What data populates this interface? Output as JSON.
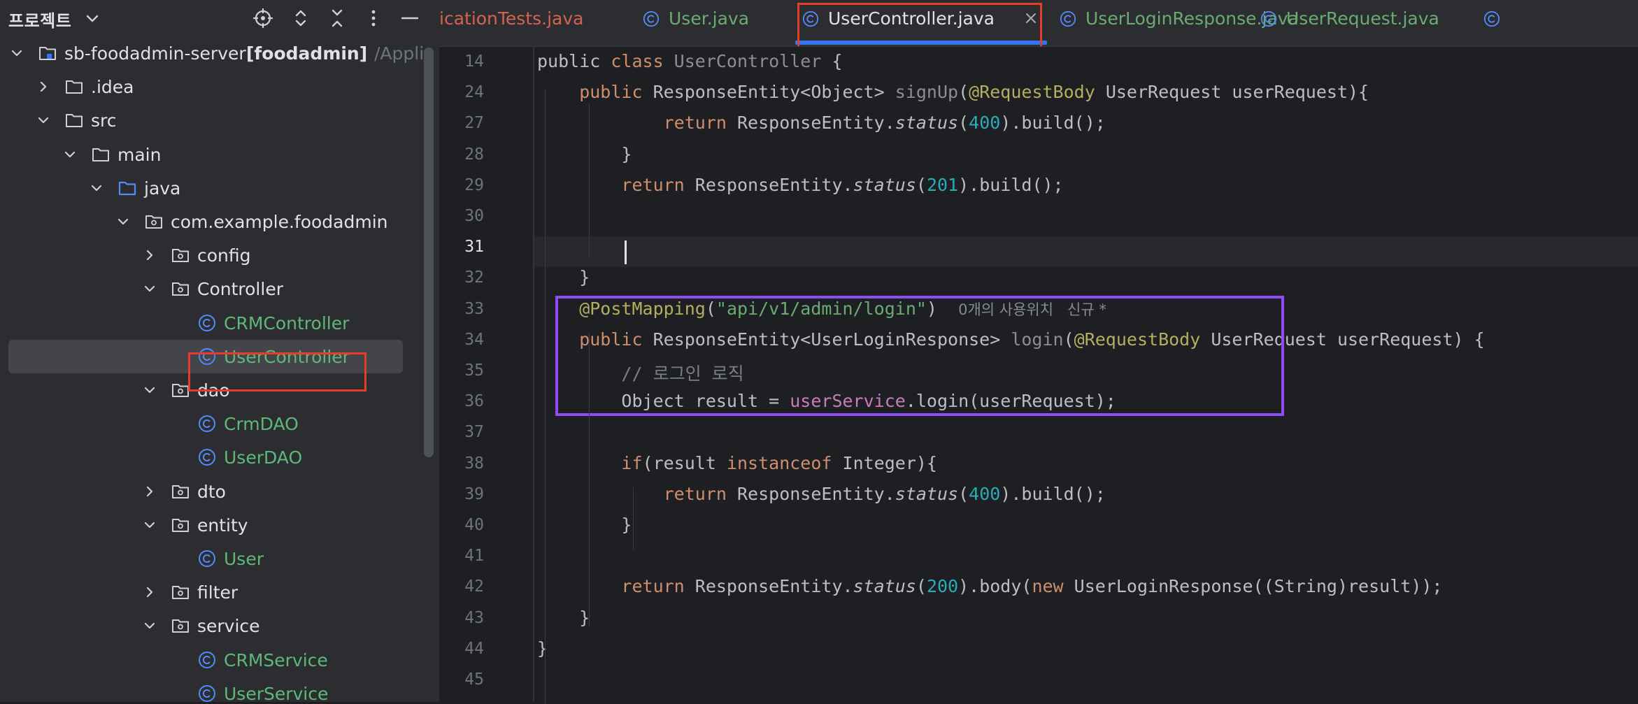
{
  "project_panel": {
    "title": "프로젝트",
    "tree": [
      {
        "label": "sb-foodadmin-server",
        "suffix": " [foodadmin]",
        "path": "/Applic",
        "depth": 0,
        "icon": "module-folder-icon",
        "expanded": true,
        "kind": "module"
      },
      {
        "label": ".idea",
        "depth": 1,
        "icon": "folder-icon",
        "expanded": false,
        "kind": "folder"
      },
      {
        "label": "src",
        "depth": 1,
        "icon": "folder-icon",
        "expanded": true,
        "kind": "folder"
      },
      {
        "label": "main",
        "depth": 2,
        "icon": "folder-icon",
        "expanded": true,
        "kind": "folder"
      },
      {
        "label": "java",
        "depth": 3,
        "icon": "source-folder-icon",
        "expanded": true,
        "kind": "source"
      },
      {
        "label": "com.example.foodadmin",
        "depth": 4,
        "icon": "package-icon",
        "expanded": true,
        "kind": "package"
      },
      {
        "label": "config",
        "depth": 5,
        "icon": "package-icon",
        "expanded": false,
        "kind": "package"
      },
      {
        "label": "Controller",
        "depth": 5,
        "icon": "package-icon",
        "expanded": true,
        "kind": "package"
      },
      {
        "label": "CRMController",
        "depth": 6,
        "icon": "class-icon",
        "kind": "class"
      },
      {
        "label": "UserController",
        "depth": 6,
        "icon": "class-icon",
        "kind": "class",
        "selected": true
      },
      {
        "label": "dao",
        "depth": 5,
        "icon": "package-icon",
        "expanded": true,
        "kind": "package"
      },
      {
        "label": "CrmDAO",
        "depth": 6,
        "icon": "class-icon",
        "kind": "class"
      },
      {
        "label": "UserDAO",
        "depth": 6,
        "icon": "class-icon",
        "kind": "class"
      },
      {
        "label": "dto",
        "depth": 5,
        "icon": "package-icon",
        "expanded": false,
        "kind": "package"
      },
      {
        "label": "entity",
        "depth": 5,
        "icon": "package-icon",
        "expanded": true,
        "kind": "package"
      },
      {
        "label": "User",
        "depth": 6,
        "icon": "class-icon",
        "kind": "class"
      },
      {
        "label": "filter",
        "depth": 5,
        "icon": "package-icon",
        "expanded": false,
        "kind": "package"
      },
      {
        "label": "service",
        "depth": 5,
        "icon": "package-icon",
        "expanded": true,
        "kind": "package"
      },
      {
        "label": "CRMService",
        "depth": 6,
        "icon": "class-icon",
        "kind": "class"
      },
      {
        "label": "UserService",
        "depth": 6,
        "icon": "class-icon",
        "kind": "class"
      }
    ]
  },
  "tabs": [
    {
      "label": "icationTests.java",
      "icon": null,
      "color": "red"
    },
    {
      "label": "User.java",
      "icon": "class-icon",
      "color": "green"
    },
    {
      "label": "UserController.java",
      "icon": "class-icon",
      "color": "active",
      "active": true
    },
    {
      "label": "UserLoginResponse.java",
      "icon": "class-icon",
      "color": "green"
    },
    {
      "label": "UserRequest.java",
      "icon": "class-icon",
      "color": "green"
    },
    {
      "label": "",
      "icon": "class-icon",
      "color": "green"
    }
  ],
  "editor": {
    "current_line": 31,
    "lines": [
      {
        "no": 14,
        "tokens": [
          [
            "t",
            "public "
          ],
          [
            "kw",
            "class "
          ],
          [
            "unused",
            "UserController"
          ],
          [
            "t",
            " {"
          ]
        ]
      },
      {
        "no": 24,
        "tokens": [
          [
            "kw",
            "    public "
          ],
          [
            "t",
            "ResponseEntity<Object> "
          ],
          [
            "unused",
            "signUp"
          ],
          [
            "t",
            "("
          ],
          [
            "ann",
            "@RequestBody"
          ],
          [
            "t",
            " UserRequest userRequest){"
          ]
        ]
      },
      {
        "no": 27,
        "tokens": [
          [
            "kw",
            "            return "
          ],
          [
            "t",
            "ResponseEntity."
          ],
          [
            "it",
            "status"
          ],
          [
            "t",
            "("
          ],
          [
            "num",
            "400"
          ],
          [
            "t",
            ").build();"
          ]
        ]
      },
      {
        "no": 28,
        "tokens": [
          [
            "t",
            "        }"
          ]
        ]
      },
      {
        "no": 29,
        "tokens": [
          [
            "kw",
            "        return "
          ],
          [
            "t",
            "ResponseEntity."
          ],
          [
            "it",
            "status"
          ],
          [
            "t",
            "("
          ],
          [
            "num",
            "201"
          ],
          [
            "t",
            ").build();"
          ]
        ]
      },
      {
        "no": 30,
        "tokens": []
      },
      {
        "no": 31,
        "tokens": []
      },
      {
        "no": 32,
        "tokens": [
          [
            "t",
            "    }"
          ]
        ]
      },
      {
        "no": 33,
        "tokens": [
          [
            "ann",
            "    @PostMapping"
          ],
          [
            "t",
            "("
          ],
          [
            "str",
            "\"api/v1/admin/login\""
          ],
          [
            "t",
            ")  "
          ],
          [
            "hint",
            "0개의 사용위치   신규 *"
          ]
        ]
      },
      {
        "no": 34,
        "tokens": [
          [
            "kw",
            "    public "
          ],
          [
            "t",
            "ResponseEntity<UserLoginResponse> "
          ],
          [
            "unused",
            "login"
          ],
          [
            "t",
            "("
          ],
          [
            "ann",
            "@RequestBody"
          ],
          [
            "t",
            " UserRequest userRequest) {"
          ]
        ]
      },
      {
        "no": 35,
        "tokens": [
          [
            "cmt",
            "        // 로그인 로직"
          ]
        ]
      },
      {
        "no": 36,
        "tokens": [
          [
            "t",
            "        Object result = "
          ],
          [
            "fld",
            "userService"
          ],
          [
            "t",
            ".login(userRequest);"
          ]
        ]
      },
      {
        "no": 37,
        "tokens": []
      },
      {
        "no": 38,
        "tokens": [
          [
            "kw",
            "        if"
          ],
          [
            "t",
            "(result "
          ],
          [
            "kw",
            "instanceof "
          ],
          [
            "t",
            "Integer){"
          ]
        ]
      },
      {
        "no": 39,
        "tokens": [
          [
            "kw",
            "            return "
          ],
          [
            "t",
            "ResponseEntity."
          ],
          [
            "it",
            "status"
          ],
          [
            "t",
            "("
          ],
          [
            "num",
            "400"
          ],
          [
            "t",
            ").build();"
          ]
        ]
      },
      {
        "no": 40,
        "tokens": [
          [
            "t",
            "        }"
          ]
        ]
      },
      {
        "no": 41,
        "tokens": []
      },
      {
        "no": 42,
        "tokens": [
          [
            "kw",
            "        return "
          ],
          [
            "t",
            "ResponseEntity."
          ],
          [
            "it",
            "status"
          ],
          [
            "t",
            "("
          ],
          [
            "num",
            "200"
          ],
          [
            "t",
            ").body("
          ],
          [
            "kw",
            "new "
          ],
          [
            "t",
            "UserLoginResponse((String)result));"
          ]
        ]
      },
      {
        "no": 43,
        "tokens": [
          [
            "t",
            "    }"
          ]
        ]
      },
      {
        "no": 44,
        "tokens": [
          [
            "t",
            "}"
          ]
        ]
      },
      {
        "no": 45,
        "tokens": []
      }
    ]
  },
  "colors": {
    "panel_bg": "#2b2d30",
    "editor_bg": "#1e1f22",
    "class_green": "#5fb878",
    "accent_blue": "#3574f0",
    "annotation_red": "#e53d2c",
    "annotation_purple": "#8e4cf4"
  }
}
